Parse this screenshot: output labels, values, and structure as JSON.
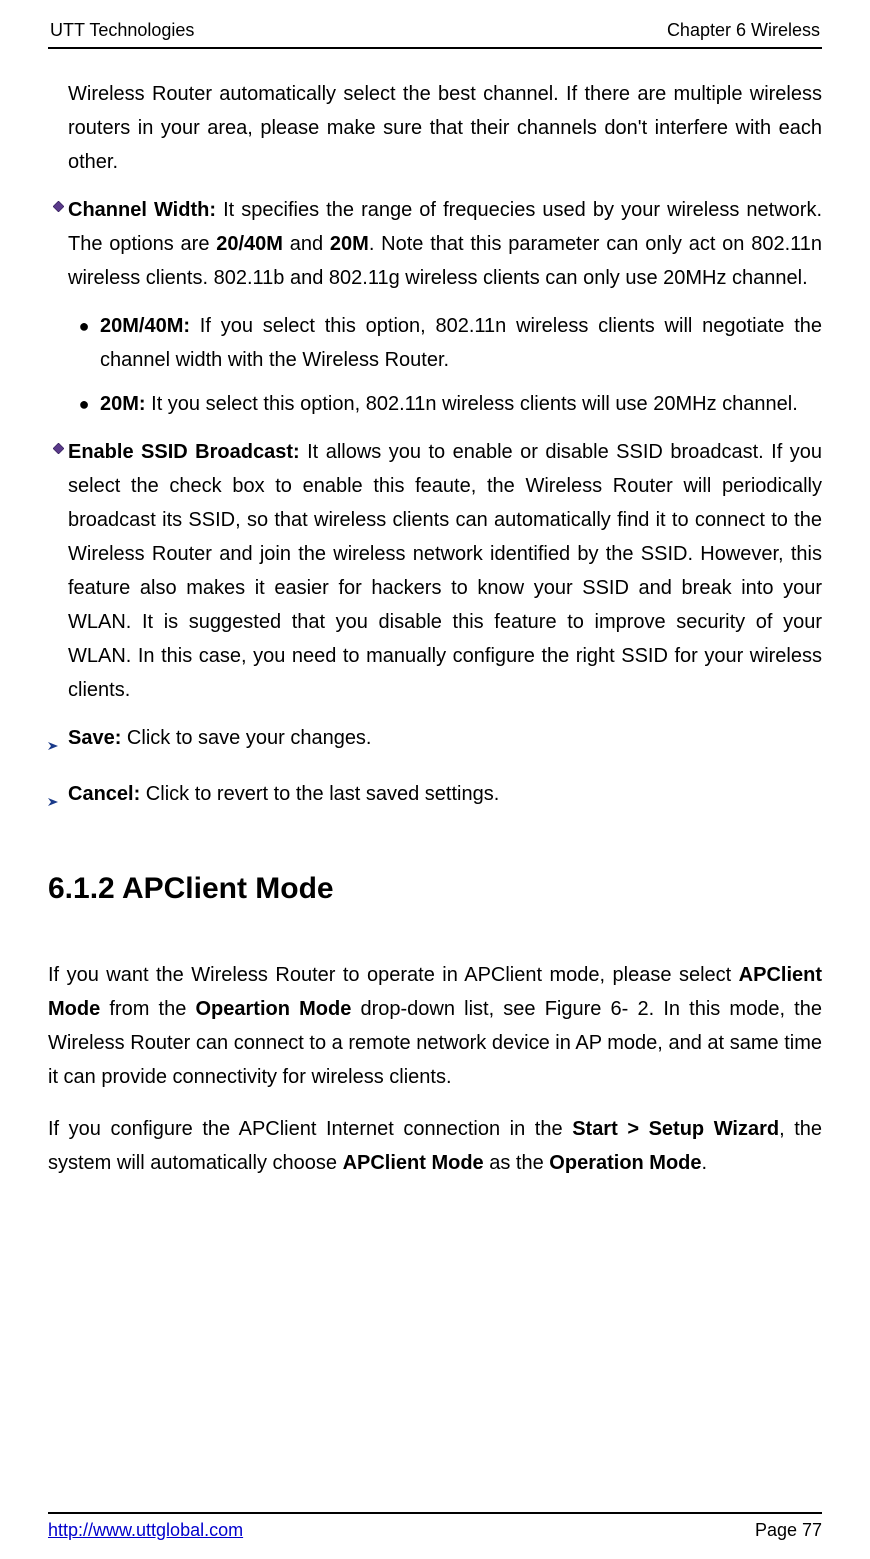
{
  "header": {
    "left": "UTT Technologies",
    "right": "Chapter 6 Wireless"
  },
  "intro_continuation": "Wireless Router automatically select the best channel. If there are multiple wireless routers in your area, please make sure that their channels don't interfere with each other.",
  "channel_width": {
    "label": "Channel Width:",
    "text1": " It specifies the range of frequecies used by your wireless network. The options are ",
    "opt1": "20/40M",
    "and": " and ",
    "opt2": "20M",
    "text2": ". Note that this parameter can only act on 802.11n wireless clients. 802.11b and 802.11g wireless clients can only use 20MHz channel."
  },
  "sub_items": [
    {
      "label": "20M/40M:",
      "text": " If you select this option, 802.11n wireless clients will negotiate the channel width with the Wireless Router."
    },
    {
      "label": "20M:",
      "text": " It you select this option, 802.11n wireless clients will use 20MHz channel."
    }
  ],
  "ssid": {
    "label": "Enable SSID Broadcast:",
    "text": " It allows you to enable or disable SSID broadcast. If you select the check box to enable this feaute, the Wireless Router will periodically broadcast its SSID, so that wireless clients can automatically find it to connect to the Wireless Router and join the wireless network identified by the SSID. However, this feature also makes it easier for hackers to know your SSID and break into your WLAN. It is suggested that you disable this feature to improve security of your WLAN. In this case, you need to manually configure the right SSID for your wireless clients."
  },
  "save": {
    "label": "Save:",
    "text": " Click to save your changes."
  },
  "cancel": {
    "label": "Cancel:",
    "text": " Click to revert to the last saved settings."
  },
  "heading": "6.1.2    APClient Mode",
  "p1": {
    "t1": "If you want the Wireless Router to operate in APClient mode, please select ",
    "b1": "APClient Mode",
    "t2": " from the ",
    "b2": "Opeartion Mode",
    "t3": " drop-down list, see Figure 6- 2. In this mode, the Wireless Router can connect to a remote network device in AP mode, and at same time it can provide connectivity for wireless clients."
  },
  "p2": {
    "t1": "If you configure the APClient Internet connection in the ",
    "b1": "Start > Setup Wizard",
    "t2": ", the system will automatically choose ",
    "b2": "APClient Mode",
    "t3": " as the ",
    "b3": "Operation Mode",
    "t4": "."
  },
  "footer": {
    "link": "http://www.uttglobal.com",
    "page": "Page 77"
  }
}
